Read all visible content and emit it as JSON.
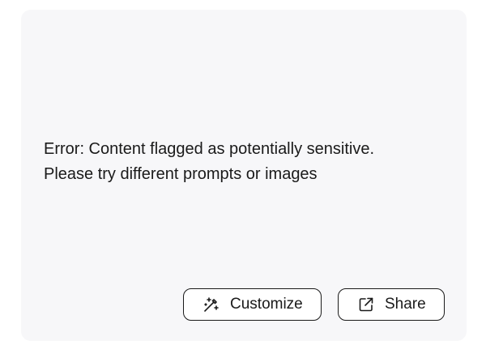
{
  "message": {
    "line1": "Error: Content flagged as potentially sensitive.",
    "line2": "Please try different prompts or images"
  },
  "actions": {
    "customize_label": "Customize",
    "customize_icon": "magic-wand-icon",
    "share_label": "Share",
    "share_icon": "external-link-icon"
  },
  "colors": {
    "card_background": "#f7f7f9",
    "text": "#1a1a1a",
    "button_background": "#ffffff"
  }
}
